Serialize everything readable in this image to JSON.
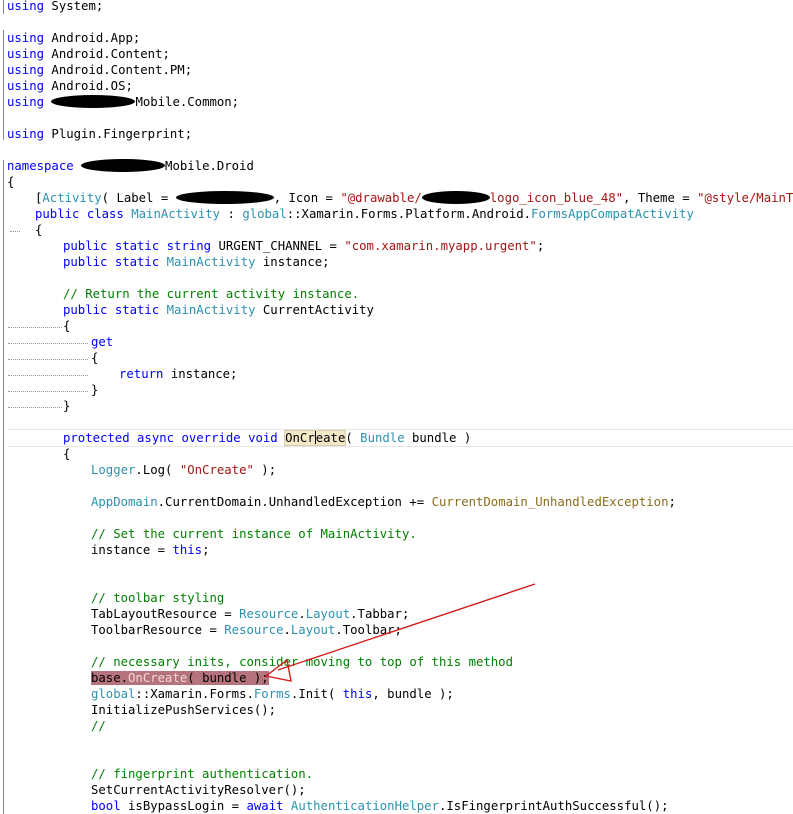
{
  "code": {
    "l1_kw": "using",
    "l1_rest": " System;",
    "l2_kw": "using",
    "l2_rest": " Android.App;",
    "l3_kw": "using",
    "l3_rest": " Android.Content;",
    "l4_kw": "using",
    "l4_rest": " Android.Content.PM;",
    "l5_kw": "using",
    "l5_rest": " Android.OS;",
    "l6_kw": "using",
    "l6_rest": "Mobile.Common;",
    "l7_kw": "using",
    "l7_rest": " Plugin.Fingerprint;",
    "l8_kw": "namespace",
    "l8_rest": "Mobile.Droid",
    "brace_open": "{",
    "brace_close": "}",
    "attr_open": "[",
    "attr_type": "Activity",
    "attr_label": "( Label = ",
    "attr_icon": ", Icon = ",
    "attr_icon_str_a": "\"@drawable/",
    "attr_icon_str_b": "logo_icon_blue_48\"",
    "attr_theme": ", Theme = ",
    "attr_theme_str": "\"@style/MainThem",
    "cls_mod": "public class",
    "cls_name": "MainActivity",
    "cls_colon": " : ",
    "cls_global": "global",
    "cls_ns": "::Xamarin.Forms.Platform.Android.",
    "cls_base": "FormsAppCompatActivity",
    "f1_mod": "public static string",
    "f1_rest": " URGENT_CHANNEL = ",
    "f1_str": "\"com.xamarin.myapp.urgent\"",
    "semi": ";",
    "f2_mod": "public static",
    "f2_type": "MainActivity",
    "f2_rest": " instance;",
    "c1": "// Return the current activity instance.",
    "p_mod": "public static",
    "p_type": "MainActivity",
    "p_rest": " CurrentActivity",
    "get_kw": "get",
    "ret_kw": "return",
    "ret_rest": " instance;",
    "m_mod": "protected async override void",
    "m_name_a": "OnCr",
    "m_name_b": "eate",
    "m_paren": "( ",
    "m_ptype": "Bundle",
    "m_rest": " bundle )",
    "log_type": "Logger",
    "log_rest": ".Log( ",
    "log_str": "\"OnCreate\"",
    "log_end": " );",
    "ad_type": "AppDomain",
    "ad_rest": ".CurrentDomain.UnhandledException += ",
    "ad_handler": "CurrentDomain_UnhandledException",
    "c2": "// Set the current instance of MainActivity.",
    "inst_a": "instance = ",
    "inst_this": "this",
    "c3": "// toolbar styling",
    "tab_a": "TabLayoutResource = ",
    "res_type": "Resource",
    "layout_type": "Layout",
    "tab_b": ".Tabbar;",
    "tb_a": "ToolbarResource = ",
    "tb_b": ".Toolbar;",
    "c4": "// necessary inits, consider moving to top of this method",
    "base_a": "base.",
    "base_name": "OnCreate",
    "base_b": "( bundle );",
    "gi_global": "global",
    "gi_ns": "::Xamarin.Forms.",
    "gi_type": "Forms",
    "gi_init": ".Init( ",
    "gi_this": "this",
    "gi_end": ", bundle );",
    "ips": "InitializePushServices();",
    "c5": "//",
    "c6": "// fingerprint authentication.",
    "scar": "SetCurrentActivityResolver();",
    "bool_kw": "bool",
    "bool_rest": " isBypassLogin = ",
    "await_kw": "await",
    "auth_type": "AuthenticationHelper",
    "auth_rest": ".IsFingerprintAuthSuccessful();"
  },
  "colors": {
    "keyword": "#0000ff",
    "type": "#2b91af",
    "string": "#a31515",
    "comment": "#008000",
    "selection": "#b5737d",
    "arrow": "#d41c1c"
  }
}
